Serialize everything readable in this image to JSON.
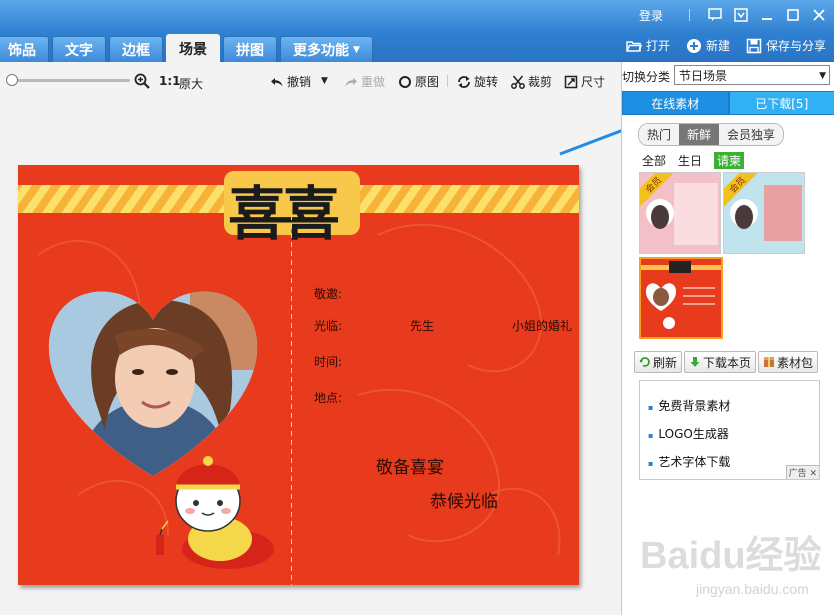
{
  "window": {
    "login": "登录"
  },
  "tabs": [
    {
      "label": "饰品"
    },
    {
      "label": "文字"
    },
    {
      "label": "边框"
    },
    {
      "label": "场景"
    },
    {
      "label": "拼图"
    },
    {
      "label": "更多功能"
    }
  ],
  "actions": {
    "open": "打开",
    "new": "新建",
    "save_share": "保存与分享"
  },
  "toolbar": {
    "ratio": "1:1",
    "original_size": "原大",
    "undo": "撤销",
    "redo": "重做",
    "original": "原图",
    "rotate": "旋转",
    "crop": "裁剪",
    "size": "尺寸"
  },
  "canvas": {
    "title": "喜喜",
    "invite_label": "敬邀:",
    "guest_label": "光临:",
    "mr": "先生",
    "wedding": "小姐的婚礼",
    "time_label": "时间:",
    "place_label": "地点:",
    "feast": "敬备喜宴",
    "welcome": "恭候光临"
  },
  "panel": {
    "category_label": "切换分类",
    "category_value": "节日场景",
    "tabs": [
      {
        "label": "在线素材"
      },
      {
        "label": "已下载[5]"
      }
    ],
    "subtabs": [
      {
        "label": "热门"
      },
      {
        "label": "新鲜"
      },
      {
        "label": "会员独享"
      }
    ],
    "filters": [
      {
        "label": "全部"
      },
      {
        "label": "生日"
      },
      {
        "label": "请柬"
      }
    ],
    "vip_badge": "会员",
    "buttons": {
      "refresh": "刷新",
      "download_page": "下载本页",
      "material_pack": "素材包"
    },
    "ads": [
      {
        "label": "免费背景素材"
      },
      {
        "label": "LOGO生成器"
      },
      {
        "label": "艺术字体下载"
      }
    ],
    "ad_tag": "广告"
  },
  "watermark": {
    "brand": "Baidu经验",
    "url": "jingyan.baidu.com"
  },
  "colors": {
    "accent": "#2f7fd0",
    "canvas_red": "#e83a1c",
    "filter_green": "#3cb034"
  }
}
